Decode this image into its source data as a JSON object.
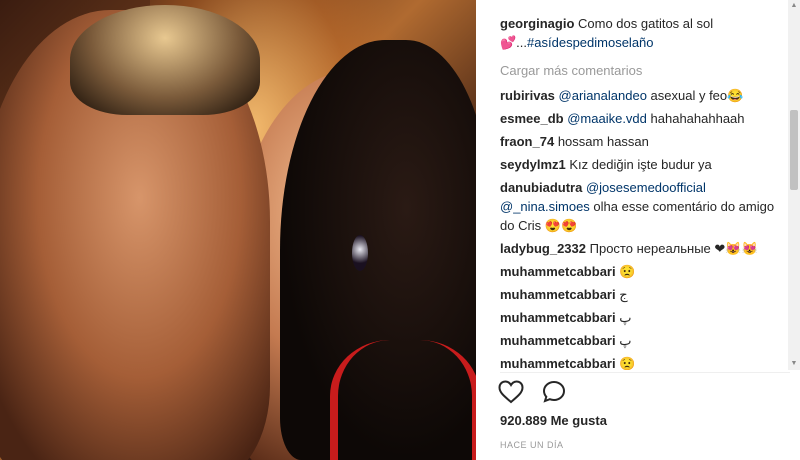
{
  "post": {
    "caption_user": "georginagio",
    "caption_text": "Como dos gatitos al sol",
    "caption_line2_emoji": "💕...",
    "caption_hashtag": "#asídespedimoselaño"
  },
  "load_more_label": "Cargar más comentarios",
  "comments": [
    {
      "user": "rubirivas",
      "mention": "@arianalandeo",
      "text": " asexual y feo😂"
    },
    {
      "user": "esmee_db",
      "mention": "@maaike.vdd",
      "text": " hahahahahhaah"
    },
    {
      "user": "fraon_74",
      "mention": "",
      "text": "hossam hassan"
    },
    {
      "user": "seydylmz1",
      "mention": "",
      "text": "Kız dediğin işte budur ya"
    },
    {
      "user": "danubiadutra",
      "mention": "@josesemedoofficial @_nina.simoes",
      "text": " olha esse comentário do amigo do Cris 😍😍"
    },
    {
      "user": "ladybug_2332",
      "mention": "",
      "text": "Просто нереальные ❤😻😻"
    },
    {
      "user": "muhammetcabbari",
      "mention": "",
      "text": "😟"
    },
    {
      "user": "muhammetcabbari",
      "mention": "",
      "text": "ج"
    },
    {
      "user": "muhammetcabbari",
      "mention": "",
      "text": "پ"
    },
    {
      "user": "muhammetcabbari",
      "mention": "",
      "text": "پ"
    },
    {
      "user": "muhammetcabbari",
      "mention": "",
      "text": "😟"
    }
  ],
  "likes": "920.889 Me gusta",
  "timestamp": "HACE UN DÍA",
  "icons": {
    "like": "heart-icon",
    "comment": "comment-bubble-icon"
  }
}
